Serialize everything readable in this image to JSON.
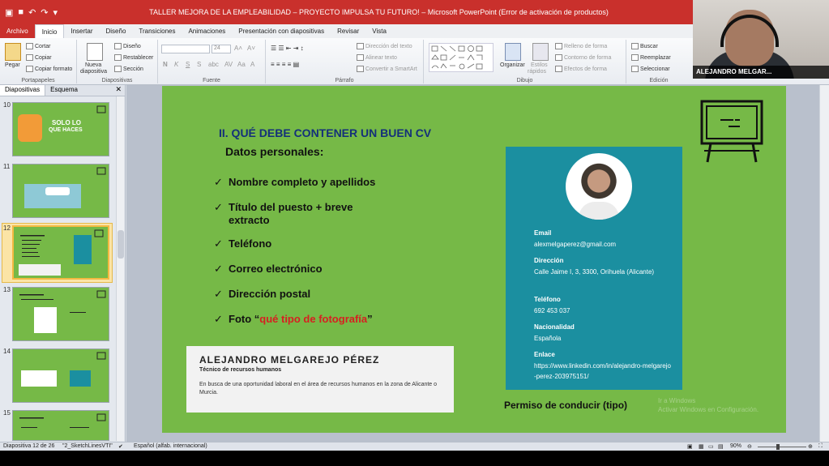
{
  "window": {
    "title": "TALLER MEJORA DE LA EMPLEABILIDAD – PROYECTO IMPULSA TU FUTURO! – Microsoft PowerPoint (Error de activación de productos)"
  },
  "ribbon_tabs": [
    "Archivo",
    "Inicio",
    "Insertar",
    "Diseño",
    "Transiciones",
    "Animaciones",
    "Presentación con diapositivas",
    "Revisar",
    "Vista"
  ],
  "ribbon": {
    "portapapeles": {
      "label": "Portapapeles",
      "pegar": "Pegar",
      "cortar": "Cortar",
      "copiar": "Copiar",
      "copiar_formato": "Copiar formato"
    },
    "diapositivas": {
      "label": "Diapositivas",
      "nueva": "Nueva",
      "diapositiva": "diapositiva",
      "diseno": "Diseño",
      "restablecer": "Restablecer",
      "seccion": "Sección"
    },
    "fuente": {
      "label": "Fuente",
      "size": "24"
    },
    "parrafo": {
      "label": "Párrafo",
      "direccion": "Dirección del texto",
      "alinear": "Alinear texto",
      "smartart": "Convertir a SmartArt"
    },
    "dibujo": {
      "label": "Dibujo",
      "organizar": "Organizar",
      "estilos": "Estilos",
      "rapidos": "rápidos",
      "relleno": "Relleno de forma",
      "contorno": "Contorno de forma",
      "efectos": "Efectos de forma"
    },
    "edicion": {
      "label": "Edición",
      "buscar": "Buscar",
      "reemplazar": "Reemplazar",
      "seleccionar": "Seleccionar"
    }
  },
  "webcam": {
    "name": "ALEJANDRO MELGAR..."
  },
  "panel": {
    "tab_slides": "Diapositivas",
    "tab_outline": "Esquema",
    "close": "✕",
    "thumbnails": [
      {
        "num": "10"
      },
      {
        "num": "11"
      },
      {
        "num": "12"
      },
      {
        "num": "13"
      },
      {
        "num": "14"
      },
      {
        "num": "15"
      }
    ],
    "thumb_text": {
      "t10a": "SOLO LO",
      "t10b": "QUE HACES"
    }
  },
  "slide": {
    "title": "II. QUÉ DEBE CONTENER UN BUEN CV",
    "subtitle": "Datos personales:",
    "bullets": [
      "Nombre completo y apellidos",
      "Título del puesto + breve extracto",
      "Teléfono",
      "Correo electrónico",
      "Dirección postal"
    ],
    "foto_prefix": "Foto “",
    "foto_red": "qué tipo de fotografía",
    "foto_suffix": "”",
    "cv": {
      "name": "ALEJANDRO MELGAREJO PÉREZ",
      "role": "Técnico de recursos humanos",
      "desc": "En busca de una oportunidad laboral en el área de recursos humanos en la zona de Alicante o Murcia."
    },
    "contact": [
      {
        "label": "Email",
        "value": "alexmelgaperez@gmail.com"
      },
      {
        "label": "Dirección",
        "value": "Calle Jaime I, 3, 3300, Orihuela (Alicante)"
      },
      {
        "label": "Teléfono",
        "value": "692 453 037"
      },
      {
        "label": "Nacionalidad",
        "value": "Española"
      },
      {
        "label": "Enlace",
        "value": "https://www.linkedin.com/in/alejandro-melgarejo-perez-203975151/"
      }
    ],
    "permiso": "Permiso de conducir (tipo)",
    "ghost": "Ir a Windows",
    "ghost2": "Activar Windows en Configuración."
  },
  "status": {
    "slide_info": "Diapositiva 12 de 26",
    "theme": "\"2_SketchLinesVTI\"",
    "language": "Español (alfab. internacional)",
    "zoom": "90%"
  },
  "colors": {
    "slide_green": "#76b947",
    "teal": "#1b8fa0",
    "title_blue": "#14307a",
    "accent_red": "#d62121",
    "file_tab": "#c9302c"
  }
}
